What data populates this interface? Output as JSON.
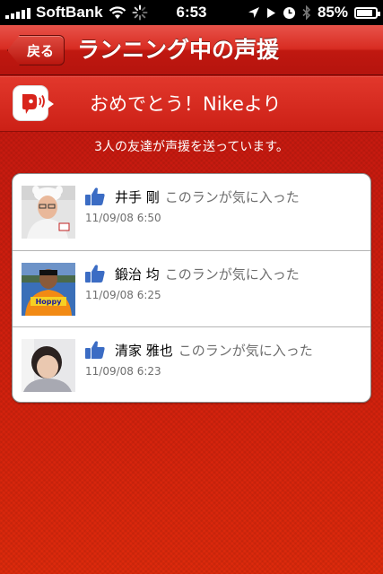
{
  "status_bar": {
    "carrier": "SoftBank",
    "time": "6:53",
    "battery": "85",
    "battery_unit": "%",
    "battery_level": 0.85
  },
  "nav": {
    "back_label": "戻る",
    "title": "ランニング中の声援"
  },
  "banner": {
    "icon": "speech-bubble-sound-icon",
    "message": "おめでとう！Nikeより"
  },
  "friends_count_text": "3人の友達が声援を送っています。",
  "cheers": [
    {
      "name": "井手 剛",
      "message": "このランが気に入った",
      "time": "11/09/08  6:50",
      "icon": "thumbs-up-icon"
    },
    {
      "name": "鍛治 均",
      "message": "このランが気に入った",
      "time": "11/09/08  6:25",
      "icon": "thumbs-up-icon"
    },
    {
      "name": "清家 雅也",
      "message": "このランが気に入った",
      "time": "11/09/08  6:23",
      "icon": "thumbs-up-icon"
    }
  ],
  "colors": {
    "accent": "#c81a10",
    "like_blue": "#3b6cc4"
  }
}
